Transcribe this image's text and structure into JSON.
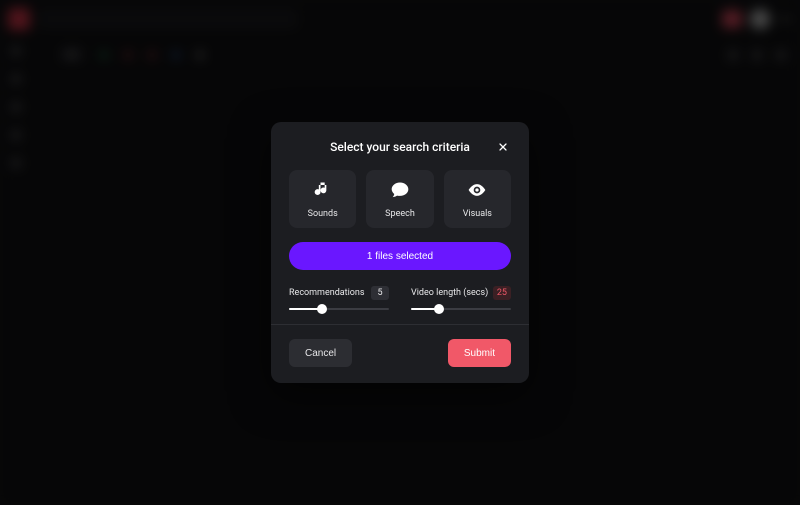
{
  "modal": {
    "title": "Select your search criteria",
    "criteria": {
      "sounds": "Sounds",
      "speech": "Speech",
      "visuals": "Visuals"
    },
    "files_button": "1 files selected",
    "sliders": {
      "recommendations": {
        "label": "Recommendations",
        "value": "5",
        "pct": 33
      },
      "video_length": {
        "label": "Video length (secs)",
        "value": "25",
        "pct": 28
      }
    },
    "actions": {
      "cancel": "Cancel",
      "submit": "Submit"
    }
  },
  "colors": {
    "accent_purple": "#6a17ff",
    "accent_red": "#f15868",
    "panel": "#1c1d21",
    "tile": "#26272c"
  }
}
